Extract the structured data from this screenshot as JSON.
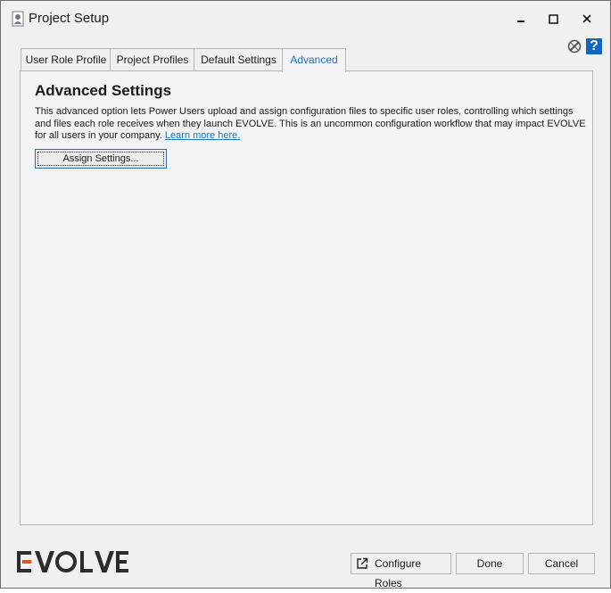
{
  "window": {
    "title": "Project Setup",
    "icons": {
      "app": "user-profile-icon",
      "minimize": "minimize-icon",
      "maximize": "maximize-icon",
      "close": "close-icon"
    }
  },
  "toolbar": {
    "settings_icon": "wrench-gear-icon",
    "help_label": "?"
  },
  "tabs": [
    {
      "label": "User Role Profile",
      "active": false
    },
    {
      "label": "Project Profiles",
      "active": false
    },
    {
      "label": "Default Settings",
      "active": false
    },
    {
      "label": "Advanced",
      "active": true
    }
  ],
  "panel": {
    "heading": "Advanced Settings",
    "description": "This advanced option lets Power Users upload and assign configuration files to specific user roles, controlling which settings and files each role receives when they launch EVOLVE. This is an uncommon configuration workflow that may impact EVOLVE for all users in your company.",
    "learn_more": "Learn more here.",
    "assign_button": "Assign Settings..."
  },
  "footer": {
    "logo_text": "EVOLVE",
    "configure_roles": "Configure Roles",
    "done": "Done",
    "cancel": "Cancel"
  },
  "colors": {
    "accent_blue": "#1e73be",
    "logo_accent": "#e8502a",
    "help_blue": "#1565c0"
  }
}
